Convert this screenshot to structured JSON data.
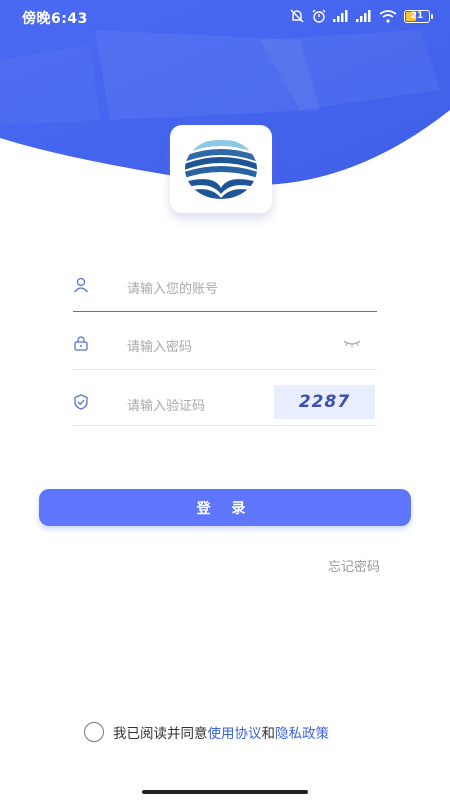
{
  "status_bar": {
    "time": "傍晚6:43",
    "battery": "21"
  },
  "app": {
    "icon": "landmark-logo-icon"
  },
  "form": {
    "account_placeholder": "请输入您的账号",
    "password_placeholder": "请输入密码",
    "captcha_placeholder": "请输入验证码",
    "captcha_code": "2287"
  },
  "actions": {
    "login_label": "登 录",
    "forgot_label": "忘记密码"
  },
  "agreement": {
    "prefix": "我已阅读并同意",
    "terms_link": "使用协议",
    "conjunction": "和",
    "privacy_link": "隐私政策"
  },
  "colors": {
    "primary": "#5d76fb",
    "hero_blue": "#4f6ef5",
    "link": "#3d63dd"
  }
}
